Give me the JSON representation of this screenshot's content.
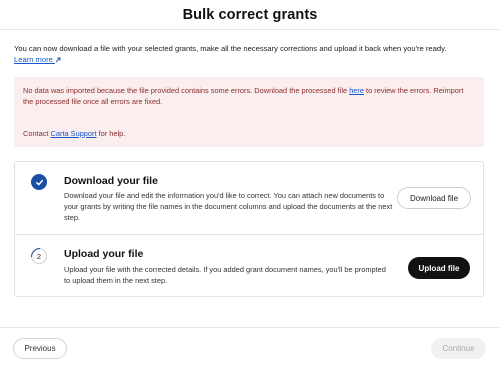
{
  "header": {
    "title": "Bulk correct grants"
  },
  "intro": {
    "text": "You can now download a file with your selected grants, make all the necessary corrections and upload it back when you're ready.",
    "learn_more": "Learn more",
    "learn_more_icon": "external-link-icon"
  },
  "error": {
    "text_before": "No data was imported because the file provided contains some errors. Download the processed file ",
    "link": "here",
    "text_after": " to review the errors. Reimport the processed file once all errors are fixed.",
    "contact_before": "Contact ",
    "contact_link": "Carta Support",
    "contact_after": " for help."
  },
  "steps": [
    {
      "status": "complete",
      "icon": "checkmark-icon",
      "title": "Download your file",
      "description": "Download your file and edit the information you'd like to correct. You can attach new documents to your grants by writing the file names in the document columns and upload the documents at the next step.",
      "button": "Download file"
    },
    {
      "status": "current",
      "number": "2",
      "title": "Upload your file",
      "description": "Upload your file with the corrected details. If you added grant document names, you'll be prompted to upload them in the next step.",
      "button": "Upload file"
    }
  ],
  "footer": {
    "previous": "Previous",
    "continue": "Continue"
  },
  "colors": {
    "primary": "#1a4fa6",
    "error_bg": "#fbeeee",
    "error_text": "#8a2d2d",
    "link": "#1657c9"
  }
}
